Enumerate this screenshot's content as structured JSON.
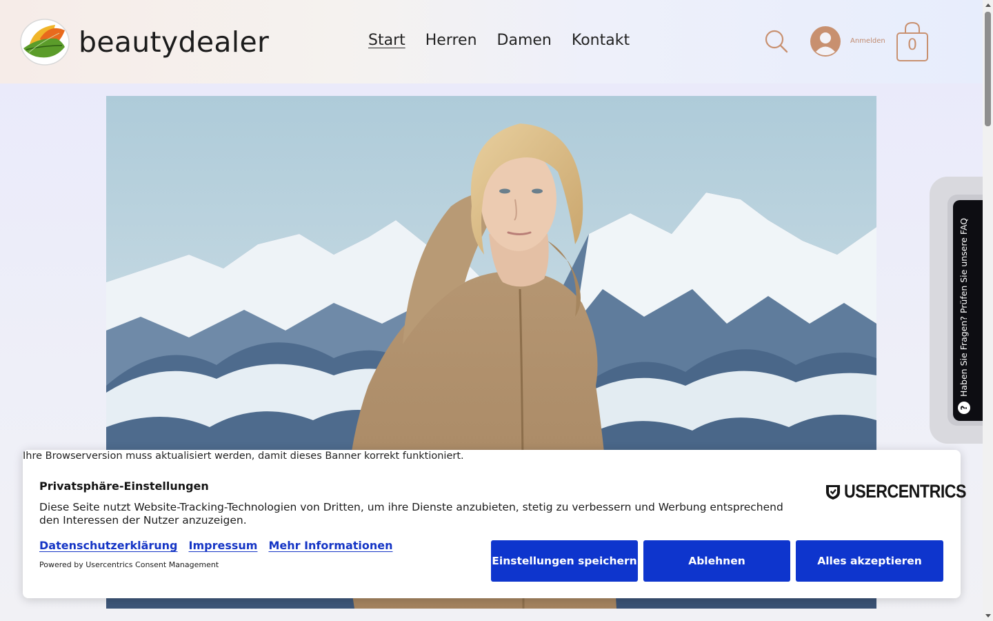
{
  "header": {
    "logo_text": "beautydealer",
    "nav": [
      {
        "label": "Start",
        "active": true
      },
      {
        "label": "Herren",
        "active": false
      },
      {
        "label": "Damen",
        "active": false
      },
      {
        "label": "Kontakt",
        "active": false
      }
    ],
    "login_label": "Anmelden",
    "cart_count": "0",
    "icons": [
      "search-icon",
      "user-avatar-icon",
      "shopping-bag-icon"
    ],
    "accent_color": "#c8906f"
  },
  "faq_tab": {
    "label": "Haben Sie Fragen? Prüfen Sie unsere FAQ",
    "icon": "?"
  },
  "consent": {
    "browser_warning": "Ihre Browserversion muss aktualisiert werden, damit dieses Banner korrekt funktioniert.",
    "title": "Privatsphäre-Einstellungen",
    "description": "Diese Seite nutzt Website-Tracking-Technologien von Dritten, um ihre Dienste anzubieten, stetig zu verbessern und Werbung entsprechend den Interessen der Nutzer anzuzeigen.",
    "links": [
      "Datenschutzerklärung",
      "Impressum",
      "Mehr Informationen"
    ],
    "powered_by": "Powered by Usercentrics Consent Management",
    "brand_logo_text": "USERCENTRICS",
    "buttons": {
      "settings": "Einstellungen speichern",
      "decline": "Ablehnen",
      "accept": "Alles akzeptieren"
    },
    "button_color": "#0e35cd",
    "link_color": "#1535c5"
  }
}
